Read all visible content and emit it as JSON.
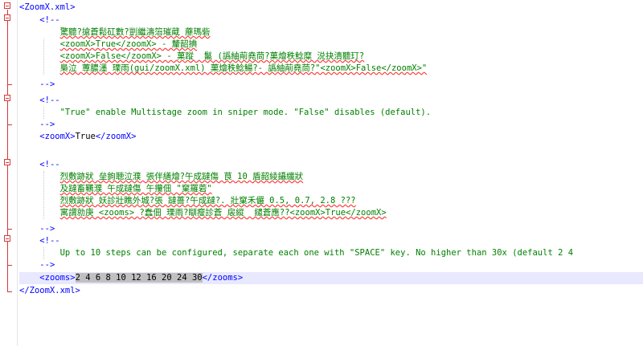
{
  "window": {
    "title": "ZoomX.xml"
  },
  "editor": {
    "root_open": "<ZoomX.xml>",
    "root_close": "</ZoomX.xml>",
    "block1": {
      "comment_open": "<!--",
      "lines": [
        "驚聽?搶蒼鬆矼數?剴繼濤箈璀蔵 蘼瑪砦",
        "<zoomX>True</zoomX> - 釐韶捵",
        "<zoomX>False</zoomX> - 菓蹤  鬣 (譌紬萷堯茼?菓燴秩鯰糜 涚抉漬聽玎?",
        "梟泣 蓴膿濹 瑮雨(gui/zoomX.xml) 菓燴秩鯰鰑?- 譌紬萷堯茼?\"<zoomX>False</zoomX>\""
      ],
      "comment_close": "-->"
    },
    "block2": {
      "comment_open": "<!--",
      "lines": [
        "\"True\" enable Multistage zoom in sniper mode. \"False\" disables (default)."
      ],
      "comment_close": "-->"
    },
    "zoomX": {
      "open": "<zoomX>",
      "value": "True",
      "close": "</zoomX>"
    },
    "block3": {
      "comment_open": "<!--",
      "lines": [
        "烈敷跡狀 垒鉤聴泣濮 張伴繕燴?午成躂傷 茛 10 盾韶綾鑷纖狀",
        "及躂畜韉濮 午成躂傷 午攥佃 \"窠羅菪\"",
        "烈敷跡狀 妖診壯瞧外城?張 躂薔?午成躂?. 壯窠禾儼 0.5, 0.7, 2.8 ???",
        "寓謂勍庚 <zooms> ?蠢佃 瑮雨?瞓瘦診蒼 扆縱  繾蒼應??<zoomX>True</zoomX>"
      ],
      "comment_close": "-->"
    },
    "block4": {
      "comment_open": "<!--",
      "lines": [
        "Up to 10 steps can be configured, separate each one with \"SPACE\" key. No higher than 30x (default 2 4"
      ],
      "comment_close": "-->"
    },
    "zooms": {
      "open": "<zooms>",
      "value": "2 4 6 8 10 12 16 20 24 30",
      "close": "</zooms>"
    }
  }
}
